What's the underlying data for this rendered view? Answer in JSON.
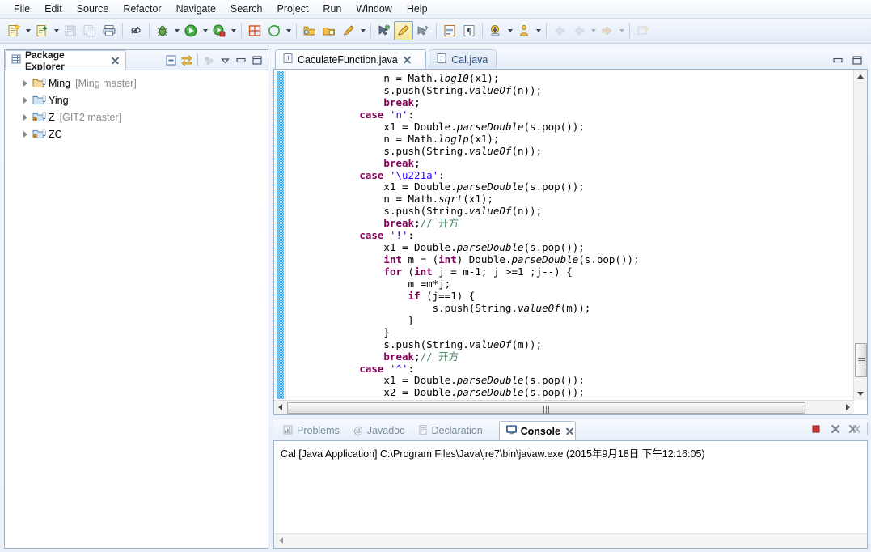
{
  "menubar": {
    "items": [
      "File",
      "Edit",
      "Source",
      "Refactor",
      "Navigate",
      "Search",
      "Project",
      "Run",
      "Window",
      "Help"
    ]
  },
  "toolbar": {
    "groups": [
      {
        "buttons": [
          {
            "name": "new-wizard",
            "icon": "new-file-icon",
            "dropdown": true,
            "enabled": true
          },
          {
            "name": "new-java-class",
            "icon": "new-class-icon",
            "dropdown": true,
            "enabled": true
          },
          {
            "name": "save",
            "icon": "save-icon",
            "dropdown": false,
            "enabled": false
          },
          {
            "name": "save-all",
            "icon": "save-all-icon",
            "dropdown": false,
            "enabled": false
          },
          {
            "name": "print",
            "icon": "print-icon",
            "dropdown": false,
            "enabled": true
          }
        ]
      },
      {
        "buttons": [
          {
            "name": "toggle-mark-occurrences",
            "icon": "mark-occurrences-icon",
            "dropdown": false,
            "enabled": true
          }
        ]
      },
      {
        "buttons": [
          {
            "name": "debug",
            "icon": "debug-bug-icon",
            "dropdown": true,
            "enabled": true
          },
          {
            "name": "run",
            "icon": "run-play-icon",
            "dropdown": true,
            "enabled": true
          },
          {
            "name": "run-coverage",
            "icon": "coverage-icon",
            "dropdown": true,
            "enabled": true
          }
        ]
      },
      {
        "buttons": [
          {
            "name": "new-java-project",
            "icon": "java-project-icon",
            "dropdown": false,
            "enabled": true
          },
          {
            "name": "new-annotation",
            "icon": "new-annotation-icon",
            "dropdown": true,
            "enabled": true
          }
        ]
      },
      {
        "buttons": [
          {
            "name": "open-type",
            "icon": "open-type-icon",
            "dropdown": false,
            "enabled": true
          },
          {
            "name": "open-task",
            "icon": "open-task-icon",
            "dropdown": false,
            "enabled": true
          },
          {
            "name": "search",
            "icon": "search-pencil-icon",
            "dropdown": true,
            "enabled": true
          }
        ]
      },
      {
        "buttons": [
          {
            "name": "next-annotation",
            "icon": "next-annotation-icon",
            "dropdown": false,
            "enabled": true
          },
          {
            "name": "previous-edit-location",
            "icon": "pencil-highlight-icon",
            "dropdown": false,
            "enabled": true,
            "pressed": true
          },
          {
            "name": "last-edit-location",
            "icon": "last-edit-icon",
            "dropdown": false,
            "enabled": true
          }
        ]
      },
      {
        "buttons": [
          {
            "name": "show-whitespace",
            "icon": "document-lines-icon",
            "dropdown": false,
            "enabled": true
          },
          {
            "name": "pilcrow",
            "icon": "pilcrow-icon",
            "dropdown": false,
            "enabled": true
          }
        ]
      },
      {
        "buttons": [
          {
            "name": "download-source",
            "icon": "yellow-download-icon",
            "dropdown": true,
            "enabled": true
          },
          {
            "name": "person-perspective",
            "icon": "person-icon",
            "dropdown": true,
            "enabled": true
          }
        ]
      },
      {
        "buttons": [
          {
            "name": "back",
            "icon": "back-arrow-icon",
            "dropdown": false,
            "enabled": false
          },
          {
            "name": "backward-history",
            "icon": "backward-arrow-icon",
            "dropdown": true,
            "enabled": false
          },
          {
            "name": "forward-history",
            "icon": "forward-arrow-icon",
            "dropdown": true,
            "enabled": false
          }
        ]
      },
      {
        "buttons": [
          {
            "name": "new-window",
            "icon": "new-window-icon",
            "dropdown": false,
            "enabled": false
          }
        ]
      }
    ]
  },
  "package_explorer": {
    "title": "Package Explorer",
    "tools": [
      {
        "name": "collapse-all-icon"
      },
      {
        "name": "link-with-editor-icon"
      },
      {
        "name": "focus-on-active-task-icon"
      },
      {
        "name": "view-menu-icon"
      },
      {
        "name": "minimize-icon"
      },
      {
        "name": "maximize-icon"
      }
    ],
    "tree": [
      {
        "label": "Ming",
        "branch": "[Ming master]",
        "icon": "java-project-icon",
        "expanded": false
      },
      {
        "label": "Ying",
        "branch": "",
        "icon": "folder-project-icon",
        "expanded": false
      },
      {
        "label": "Z",
        "branch": "[GIT2 master]",
        "icon": "git-project-icon",
        "expanded": false
      },
      {
        "label": "ZC",
        "branch": "",
        "icon": "git-project-icon",
        "expanded": false
      }
    ]
  },
  "editor": {
    "tabs": [
      {
        "label": "CaculateFunction.java",
        "active": true,
        "icon": "java-file-icon",
        "closable": true
      },
      {
        "label": "Cal.java",
        "active": false,
        "icon": "java-file-icon",
        "closable": false
      }
    ],
    "code_lines": [
      [
        {
          "t": "                ",
          "c": "plain"
        },
        {
          "t": "n = Math.",
          "c": "plain"
        },
        {
          "t": "log10",
          "c": "ital"
        },
        {
          "t": "(x1);",
          "c": "plain"
        }
      ],
      [
        {
          "t": "                ",
          "c": "plain"
        },
        {
          "t": "s.push(String.",
          "c": "plain"
        },
        {
          "t": "valueOf",
          "c": "ital"
        },
        {
          "t": "(n));",
          "c": "plain"
        }
      ],
      [
        {
          "t": "                ",
          "c": "plain"
        },
        {
          "t": "break",
          "c": "kw"
        },
        {
          "t": ";",
          "c": "plain"
        }
      ],
      [
        {
          "t": "            ",
          "c": "plain"
        },
        {
          "t": "case",
          "c": "kw"
        },
        {
          "t": " ",
          "c": "plain"
        },
        {
          "t": "'n'",
          "c": "str"
        },
        {
          "t": ":",
          "c": "plain"
        }
      ],
      [
        {
          "t": "                ",
          "c": "plain"
        },
        {
          "t": "x1 = Double.",
          "c": "plain"
        },
        {
          "t": "parseDouble",
          "c": "ital"
        },
        {
          "t": "(s.pop());",
          "c": "plain"
        }
      ],
      [
        {
          "t": "                ",
          "c": "plain"
        },
        {
          "t": "n = Math.",
          "c": "plain"
        },
        {
          "t": "log1p",
          "c": "ital"
        },
        {
          "t": "(x1);",
          "c": "plain"
        }
      ],
      [
        {
          "t": "                ",
          "c": "plain"
        },
        {
          "t": "s.push(String.",
          "c": "plain"
        },
        {
          "t": "valueOf",
          "c": "ital"
        },
        {
          "t": "(n));",
          "c": "plain"
        }
      ],
      [
        {
          "t": "                ",
          "c": "plain"
        },
        {
          "t": "break",
          "c": "kw"
        },
        {
          "t": ";",
          "c": "plain"
        }
      ],
      [
        {
          "t": "            ",
          "c": "plain"
        },
        {
          "t": "case",
          "c": "kw"
        },
        {
          "t": " ",
          "c": "plain"
        },
        {
          "t": "'\\u221a'",
          "c": "str"
        },
        {
          "t": ":",
          "c": "plain"
        }
      ],
      [
        {
          "t": "                ",
          "c": "plain"
        },
        {
          "t": "x1 = Double.",
          "c": "plain"
        },
        {
          "t": "parseDouble",
          "c": "ital"
        },
        {
          "t": "(s.pop());",
          "c": "plain"
        }
      ],
      [
        {
          "t": "                ",
          "c": "plain"
        },
        {
          "t": "n = Math.",
          "c": "plain"
        },
        {
          "t": "sqrt",
          "c": "ital"
        },
        {
          "t": "(x1);",
          "c": "plain"
        }
      ],
      [
        {
          "t": "                ",
          "c": "plain"
        },
        {
          "t": "s.push(String.",
          "c": "plain"
        },
        {
          "t": "valueOf",
          "c": "ital"
        },
        {
          "t": "(n));",
          "c": "plain"
        }
      ],
      [
        {
          "t": "                ",
          "c": "plain"
        },
        {
          "t": "break",
          "c": "kw"
        },
        {
          "t": ";",
          "c": "plain"
        },
        {
          "t": "// 开方",
          "c": "cmt"
        }
      ],
      [
        {
          "t": "            ",
          "c": "plain"
        },
        {
          "t": "case",
          "c": "kw"
        },
        {
          "t": " ",
          "c": "plain"
        },
        {
          "t": "'!'",
          "c": "str"
        },
        {
          "t": ":",
          "c": "plain"
        }
      ],
      [
        {
          "t": "                ",
          "c": "plain"
        },
        {
          "t": "x1 = Double.",
          "c": "plain"
        },
        {
          "t": "parseDouble",
          "c": "ital"
        },
        {
          "t": "(s.pop());",
          "c": "plain"
        }
      ],
      [
        {
          "t": "                ",
          "c": "plain"
        },
        {
          "t": "int",
          "c": "kw"
        },
        {
          "t": " m = (",
          "c": "plain"
        },
        {
          "t": "int",
          "c": "kw"
        },
        {
          "t": ") Double.",
          "c": "plain"
        },
        {
          "t": "parseDouble",
          "c": "ital"
        },
        {
          "t": "(s.pop());",
          "c": "plain"
        }
      ],
      [
        {
          "t": "                ",
          "c": "plain"
        },
        {
          "t": "for",
          "c": "kw"
        },
        {
          "t": " (",
          "c": "plain"
        },
        {
          "t": "int",
          "c": "kw"
        },
        {
          "t": " j = m-1; j >=1 ;j--) {",
          "c": "plain"
        }
      ],
      [
        {
          "t": "                    ",
          "c": "plain"
        },
        {
          "t": "m =m*j;",
          "c": "plain"
        }
      ],
      [
        {
          "t": "                    ",
          "c": "plain"
        },
        {
          "t": "if",
          "c": "kw"
        },
        {
          "t": " (j==1) {",
          "c": "plain"
        }
      ],
      [
        {
          "t": "                        ",
          "c": "plain"
        },
        {
          "t": "s.push(String.",
          "c": "plain"
        },
        {
          "t": "valueOf",
          "c": "ital"
        },
        {
          "t": "(m));",
          "c": "plain"
        }
      ],
      [
        {
          "t": "                    ",
          "c": "plain"
        },
        {
          "t": "}",
          "c": "plain"
        }
      ],
      [
        {
          "t": "                ",
          "c": "plain"
        },
        {
          "t": "}",
          "c": "plain"
        }
      ],
      [
        {
          "t": "                ",
          "c": "plain"
        },
        {
          "t": "s.push(String.",
          "c": "plain"
        },
        {
          "t": "valueOf",
          "c": "ital"
        },
        {
          "t": "(m));",
          "c": "plain"
        }
      ],
      [
        {
          "t": "                ",
          "c": "plain"
        },
        {
          "t": "break",
          "c": "kw"
        },
        {
          "t": ";",
          "c": "plain"
        },
        {
          "t": "// 开方",
          "c": "cmt"
        }
      ],
      [
        {
          "t": "            ",
          "c": "plain"
        },
        {
          "t": "case",
          "c": "kw"
        },
        {
          "t": " ",
          "c": "plain"
        },
        {
          "t": "'^'",
          "c": "str"
        },
        {
          "t": ":",
          "c": "plain"
        }
      ],
      [
        {
          "t": "                ",
          "c": "plain"
        },
        {
          "t": "x1 = Double.",
          "c": "plain"
        },
        {
          "t": "parseDouble",
          "c": "ital"
        },
        {
          "t": "(s.pop());",
          "c": "plain"
        }
      ],
      [
        {
          "t": "                ",
          "c": "plain"
        },
        {
          "t": "x2 = Double.",
          "c": "plain"
        },
        {
          "t": "parseDouble",
          "c": "ital"
        },
        {
          "t": "(s.pop());",
          "c": "plain"
        }
      ]
    ]
  },
  "console": {
    "tabs": [
      {
        "label": "Problems",
        "active": false,
        "icon": "problems-icon"
      },
      {
        "label": "Javadoc",
        "active": false,
        "icon": "javadoc-at-icon"
      },
      {
        "label": "Declaration",
        "active": false,
        "icon": "declaration-icon"
      },
      {
        "label": "Console",
        "active": true,
        "icon": "console-icon"
      }
    ],
    "tools": [
      {
        "name": "terminate-icon",
        "color": "#cc3333"
      },
      {
        "name": "remove-launch-icon"
      },
      {
        "name": "remove-all-terminated-icon"
      }
    ],
    "output": "Cal [Java Application] C:\\Program Files\\Java\\jre7\\bin\\javaw.exe (2015年9月18日 下午12:16:05)"
  },
  "colors": {
    "keyword": "#7f0055",
    "string": "#2a00ff",
    "comment": "#3f7f5f",
    "fold_band": "#3fa8e8",
    "accent": "#f5a623"
  }
}
